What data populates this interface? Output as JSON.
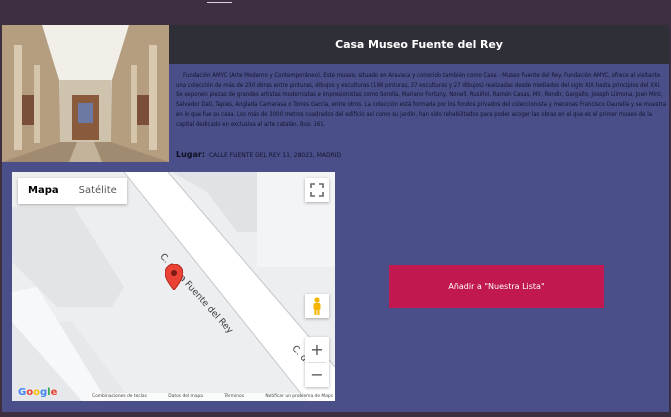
{
  "museum": {
    "title": "Casa Museo Fuente del Rey",
    "description": "Fundación AMYC (Arte Moderno y Contemporáneo). Este museo, situado en Aravaca y conocido también como Casa - Museo Fuente del Rey. Fundación AMYC, ofrece al visitante una colección de más de 250 obras entre pinturas, dibujos y esculturas (198 pinturas, 37 esculturas y 27 dibujos) realizadas desde mediados del siglo XIX hasta principios del XXI. Se exponen piezas de grandes artistas modernistas e impresionistas como Sorolla, Mariano Fortuny, Nonell, Rusiñol, Ramón Casas, Mir, Rendir, Gargallo, Joseph Llimona, Joan Miró, Salvador Dalí, Tapies, Anglada Camarasa o Torres García, entre otros. La colección está formada por los fondos privados del coleccionista y mecenas Francisco Daurella y se muestra en lo que fue su casa. Los más de 3000 metros cuadrados del edificio así como su jardín, han sido rehabilitados para poder acoger las obras en el que es el primer museo de la capital dedicado en exclusiva al arte catalán.  Bus: 161.",
    "location_label": "Lugar:",
    "location_value": "CALLE FUENTE DEL REY 11, 28023, MADRID"
  },
  "map": {
    "type_options": [
      "Mapa",
      "Satélite"
    ],
    "selected_type": "Mapa",
    "street_name": "C. de la Fuente del Rey",
    "street_name_partial": "C. de",
    "zoom_in": "+",
    "zoom_out": "−",
    "logo_letters": [
      "G",
      "o",
      "o",
      "g",
      "l",
      "e"
    ],
    "attribution": [
      "Combinaciones de teclas",
      "Datos del mapa",
      "Términos",
      "Notificar un problema de Maps"
    ]
  },
  "actions": {
    "add_label": "Añadir a \"Nuestra Lista\""
  },
  "colors": {
    "card_bg": "#4a4f8a",
    "title_bg": "#2f2f38",
    "button_bg": "#c0184f",
    "marker": "#ea4335"
  },
  "icons": [
    "fullscreen-icon",
    "pegman-icon",
    "map-marker-icon"
  ]
}
